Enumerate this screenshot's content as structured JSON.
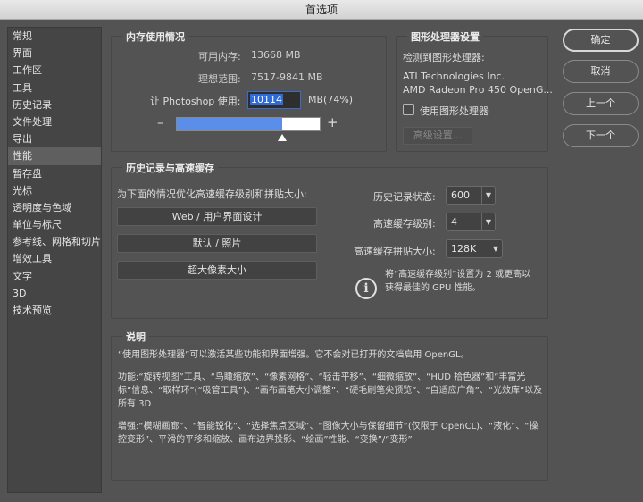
{
  "window": {
    "title": "首选项"
  },
  "sidebar": {
    "items": [
      {
        "label": "常规"
      },
      {
        "label": "界面"
      },
      {
        "label": "工作区"
      },
      {
        "label": "工具"
      },
      {
        "label": "历史记录"
      },
      {
        "label": "文件处理"
      },
      {
        "label": "导出"
      },
      {
        "label": "性能"
      },
      {
        "label": "暂存盘"
      },
      {
        "label": "光标"
      },
      {
        "label": "透明度与色域"
      },
      {
        "label": "单位与标尺"
      },
      {
        "label": "参考线、网格和切片"
      },
      {
        "label": "增效工具"
      },
      {
        "label": "文字"
      },
      {
        "label": "3D"
      },
      {
        "label": "技术预览"
      }
    ],
    "active_index": 7
  },
  "memory": {
    "title": "内存使用情况",
    "available_label": "可用内存:",
    "available_value": "13668 MB",
    "ideal_label": "理想范围:",
    "ideal_value": "7517-9841 MB",
    "let_label": "让 Photoshop 使用:",
    "let_value": "10114",
    "let_suffix": "MB(74%)",
    "minus": "–",
    "plus": "+",
    "slider_fraction": 0.74
  },
  "gpu": {
    "title": "图形处理器设置",
    "detected_label": "检测到图形处理器:",
    "vendor": "ATI Technologies Inc.",
    "model": "AMD Radeon Pro 450 OpenG...",
    "use_gpu_label": "使用图形处理器",
    "use_gpu_checked": false,
    "advanced_label": "高级设置..."
  },
  "history_cache": {
    "title": "历史记录与高速缓存",
    "optimize_label": "为下面的情况优化高速缓存级别和拼贴大小:",
    "btn_web": "Web / 用户界面设计",
    "btn_default": "默认 / 照片",
    "btn_huge": "超大像素大小",
    "history_states_label": "历史记录状态:",
    "history_states_value": "600",
    "cache_levels_label": "高速缓存级别:",
    "cache_levels_value": "4",
    "tile_size_label": "高速缓存拼贴大小:",
    "tile_size_value": "128K",
    "info_line1": "将“高速缓存级别”设置为 2 或更高以",
    "info_line2": "获得最佳的 GPU 性能。",
    "info_icon": "i"
  },
  "description": {
    "title": "说明",
    "para1": "“使用图形处理器”可以激活某些功能和界面增强。它不会对已打开的文档启用 OpenGL。",
    "para2": "功能:“旋转视图”工具、“鸟瞰缩放”、“像素网格”、“轻击平移”、“细微缩放”、“HUD 拾色器”和“丰富光标”信息、“取样环”(“吸管工具”)、“画布画笔大小调整”、“硬毛刷笔尖预览”、“自适应广角”、“光效库”以及所有 3D",
    "para3": "增强:“模糊画廊”、“智能锐化”、“选择焦点区域”、“图像大小与保留细节”(仅限于 OpenCL)、“液化”、“操控变形”、平滑的平移和缩放、画布边界投影、“绘画”性能、“变换”/“变形”"
  },
  "buttons": {
    "ok": "确定",
    "cancel": "取消",
    "prev": "上一个",
    "next": "下一个"
  }
}
